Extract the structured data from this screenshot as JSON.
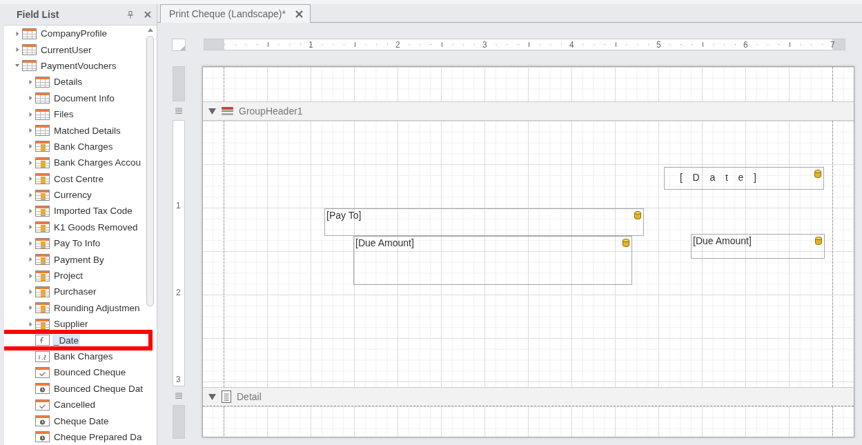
{
  "field_list": {
    "title": "Field List",
    "tree": [
      {
        "label": "CompanyProfile",
        "kind": "table",
        "expanded": false,
        "selected": false
      },
      {
        "label": "CurrentUser",
        "kind": "table",
        "expanded": false,
        "selected": false
      },
      {
        "label": "PaymentVouchers",
        "kind": "table",
        "expanded": true,
        "selected": false,
        "children": [
          {
            "label": "Details",
            "kind": "table",
            "expanded": false,
            "selected": false
          },
          {
            "label": "Document Info",
            "kind": "table",
            "expanded": false,
            "selected": false
          },
          {
            "label": "Files",
            "kind": "table",
            "expanded": false,
            "selected": false
          },
          {
            "label": "Matched Details",
            "kind": "table",
            "expanded": false,
            "selected": false
          },
          {
            "label": "Bank Charges",
            "kind": "relation",
            "expanded": false,
            "selected": false
          },
          {
            "label": "Bank Charges Accou",
            "kind": "relation",
            "expanded": false,
            "selected": false
          },
          {
            "label": "Cost Centre",
            "kind": "relation",
            "expanded": false,
            "selected": false
          },
          {
            "label": "Currency",
            "kind": "relation",
            "expanded": false,
            "selected": false
          },
          {
            "label": "Imported Tax Code",
            "kind": "relation",
            "expanded": false,
            "selected": false
          },
          {
            "label": "K1 Goods Removed",
            "kind": "relation",
            "expanded": false,
            "selected": false
          },
          {
            "label": "Pay To Info",
            "kind": "relation",
            "expanded": false,
            "selected": false
          },
          {
            "label": "Payment By",
            "kind": "relation",
            "expanded": false,
            "selected": false
          },
          {
            "label": "Project",
            "kind": "relation",
            "expanded": false,
            "selected": false
          },
          {
            "label": "Purchaser",
            "kind": "relation",
            "expanded": false,
            "selected": false
          },
          {
            "label": "Rounding Adjustmen",
            "kind": "relation",
            "expanded": false,
            "selected": false
          },
          {
            "label": "Supplier",
            "kind": "relation",
            "expanded": false,
            "selected": false
          },
          {
            "label": "_Date",
            "kind": "calculated",
            "selected": true,
            "highlighted": true
          },
          {
            "label": "Bank Charges",
            "kind": "number",
            "selected": false
          },
          {
            "label": "Bounced Cheque",
            "kind": "boolean",
            "selected": false
          },
          {
            "label": "Bounced Cheque Dat",
            "kind": "datetime",
            "selected": false
          },
          {
            "label": "Cancelled",
            "kind": "boolean",
            "selected": false
          },
          {
            "label": "Cheque Date",
            "kind": "datetime",
            "selected": false
          },
          {
            "label": "Cheque Prepared Da",
            "kind": "datetime",
            "selected": false
          }
        ]
      }
    ]
  },
  "tabs": [
    {
      "label": "Print Cheque (Landscape)*",
      "selected": true
    }
  ],
  "horizontal_ruler": [
    "1",
    "2",
    "3",
    "4",
    "5",
    "6",
    "7"
  ],
  "vertical_ruler": [
    "1",
    "2",
    "3"
  ],
  "bands": [
    {
      "name": "GroupHeader1",
      "kind": "group-header",
      "expanded": true,
      "controls": [
        {
          "text": "[Date]",
          "spaced": true
        },
        {
          "text": "[Pay To]",
          "spaced": false
        },
        {
          "text": "[Due Amount]",
          "spaced": false
        },
        {
          "text": "[Due Amount]",
          "spaced": false
        }
      ]
    },
    {
      "name": "Detail",
      "kind": "detail",
      "expanded": true
    }
  ]
}
